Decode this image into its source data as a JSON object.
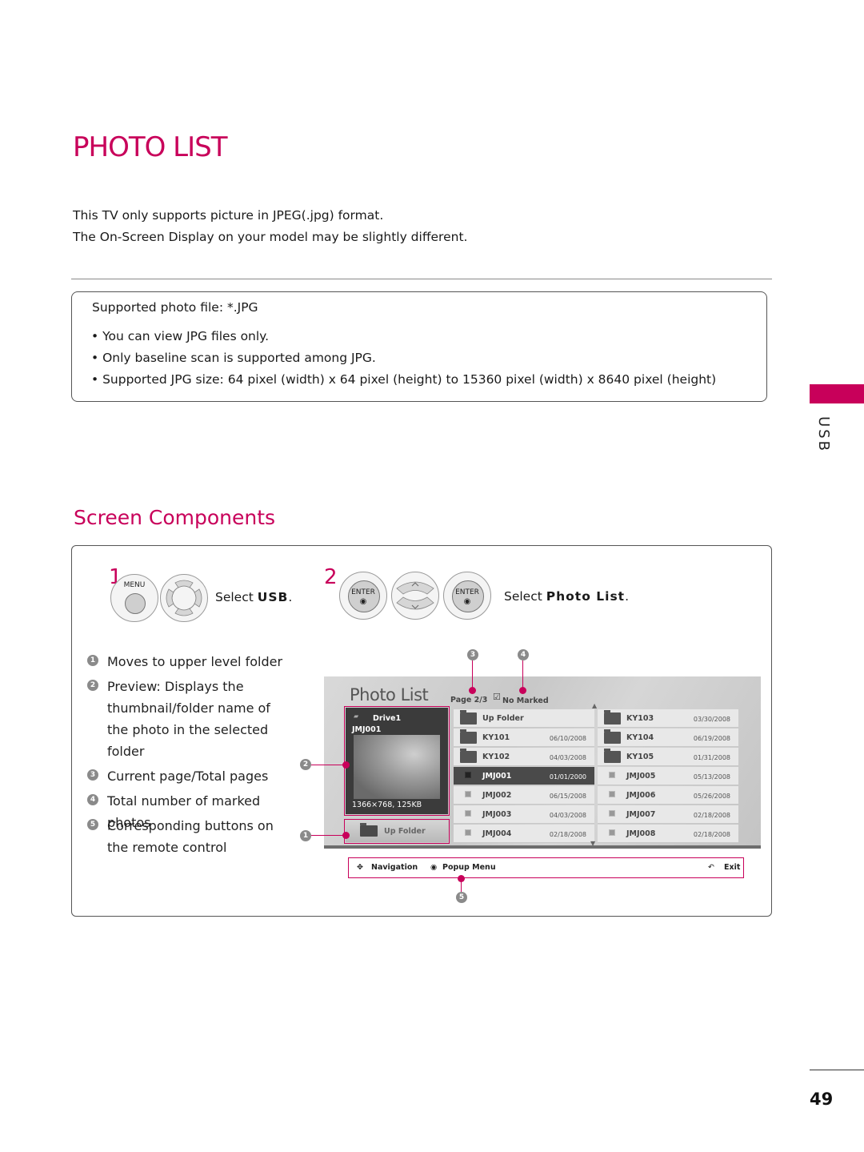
{
  "page": {
    "title": "PHOTO LIST",
    "intro_lines": [
      "This TV only supports picture in JPEG(.jpg) format.",
      "The On-Screen Display on your model may be slightly different."
    ],
    "accent_color": "#c8005a",
    "side_tab": "USB",
    "page_number": "49"
  },
  "note": {
    "title": "Supported photo file: *.JPG",
    "items": [
      "• You can view JPG files only.",
      "• Only baseline scan is supported among JPG.",
      "• Supported JPG size: 64 pixel (width) x 64 pixel (height) to 15360 pixel (width) x 8640 pixel (height)"
    ]
  },
  "section": {
    "title": "Screen Components"
  },
  "steps": [
    {
      "number": "1",
      "buttons": [
        {
          "label": "MENU",
          "icon": "menu-button-icon"
        },
        {
          "label": "",
          "icon": "dpad-four-way-icon"
        }
      ],
      "text_prefix": "Select ",
      "text_bold": "USB",
      "text_suffix": "."
    },
    {
      "number": "2",
      "buttons": [
        {
          "label": "ENTER",
          "icon": "enter-button-icon"
        },
        {
          "label": "",
          "icon": "dpad-up-down-icon"
        },
        {
          "label": "ENTER",
          "icon": "enter-button-icon"
        }
      ],
      "text_prefix": "Select ",
      "text_bold": "Photo List",
      "text_suffix": "."
    }
  ],
  "legend": [
    {
      "num": "1",
      "lines": [
        "Moves to upper level folder"
      ]
    },
    {
      "num": "2",
      "lines": [
        "Preview: Displays the",
        "thumbnail/folder name of",
        "the photo in the selected",
        "folder"
      ]
    },
    {
      "num": "3",
      "lines": [
        "Current page/Total pages"
      ]
    },
    {
      "num": "4",
      "lines": [
        "Total number of marked photos"
      ]
    },
    {
      "num": "5",
      "lines": [
        "Corresponding buttons on",
        "the remote control"
      ]
    }
  ],
  "tv_screen": {
    "title": "Photo List",
    "page_indicator": "Page 2/3",
    "marked_status": "No Marked",
    "preview": {
      "drive": "Drive1",
      "filename": "JMJ001",
      "info": "1366×768, 125KB"
    },
    "up_folder_button": "Up Folder",
    "left_column": [
      {
        "type": "upfolder",
        "name": "Up Folder",
        "date": ""
      },
      {
        "type": "folder",
        "name": "KY101",
        "date": "06/10/2008"
      },
      {
        "type": "folder",
        "name": "KY102",
        "date": "04/03/2008"
      },
      {
        "type": "file",
        "name": "JMJ001",
        "date": "01/01/2000",
        "selected": true
      },
      {
        "type": "file",
        "name": "JMJ002",
        "date": "06/15/2008"
      },
      {
        "type": "file",
        "name": "JMJ003",
        "date": "04/03/2008"
      },
      {
        "type": "file",
        "name": "JMJ004",
        "date": "02/18/2008"
      }
    ],
    "right_column": [
      {
        "type": "folder",
        "name": "KY103",
        "date": "03/30/2008"
      },
      {
        "type": "folder",
        "name": "KY104",
        "date": "06/19/2008"
      },
      {
        "type": "folder",
        "name": "KY105",
        "date": "01/31/2008"
      },
      {
        "type": "file",
        "name": "JMJ005",
        "date": "05/13/2008"
      },
      {
        "type": "file",
        "name": "JMJ006",
        "date": "05/26/2008"
      },
      {
        "type": "file",
        "name": "JMJ007",
        "date": "02/18/2008"
      },
      {
        "type": "file",
        "name": "JMJ008",
        "date": "02/18/2008"
      }
    ],
    "nav_bar": {
      "navigation": "Navigation",
      "popup_menu": "Popup Menu",
      "exit": "Exit"
    },
    "callouts": [
      "1",
      "2",
      "3",
      "4",
      "5"
    ]
  }
}
